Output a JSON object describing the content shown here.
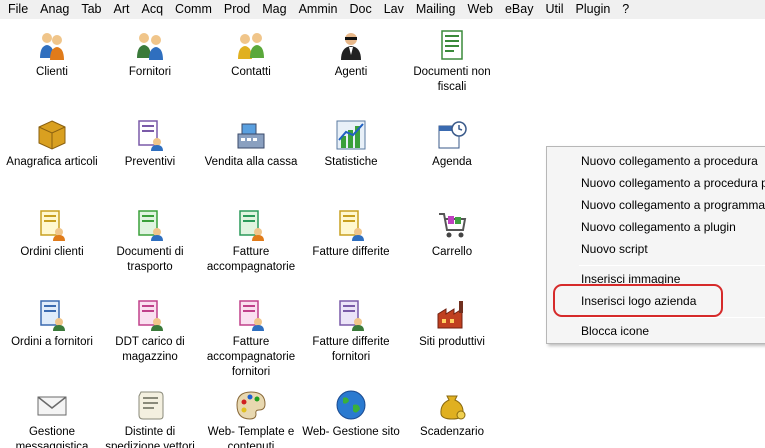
{
  "menubar": {
    "items": [
      "File",
      "Anag",
      "Tab",
      "Art",
      "Acq",
      "Comm",
      "Prod",
      "Mag",
      "Ammin",
      "Doc",
      "Lav",
      "Mailing",
      "Web",
      "eBay",
      "Util",
      "Plugin",
      "?"
    ]
  },
  "icons": {
    "clienti": "Clienti",
    "fornitori": "Fornitori",
    "contatti": "Contatti",
    "agenti": "Agenti",
    "documenti_non_fiscali": "Documenti non fiscali",
    "anagrafica_articoli": "Anagrafica articoli",
    "preventivi": "Preventivi",
    "vendita_alla_cassa": "Vendita alla cassa",
    "statistiche": "Statistiche",
    "agenda": "Agenda",
    "ordini_clienti": "Ordini clienti",
    "documenti_di_trasporto": "Documenti di trasporto",
    "fatture_accompagnatorie": "Fatture accompagnatorie",
    "fatture_differite": "Fatture differite",
    "carrello": "Carrello",
    "ordini_a_fornitori": "Ordini a fornitori",
    "ddt_carico_magazzino": "DDT carico di magazzino",
    "fatture_accompagnatorie_fornitori": "Fatture accompagnatorie fornitori",
    "fatture_differite_fornitori": "Fatture differite fornitori",
    "siti_produttivi": "Siti produttivi",
    "gestione_messaggistica": "Gestione messaggistica",
    "distinte_spedizione_vettori": "Distinte di spedizione vettori",
    "web_template_contenuti": "Web- Template e contenuti",
    "web_gestione_sito": "Web- Gestione sito",
    "scadenzario": "Scadenzario"
  },
  "context_menu": {
    "nuovo_collegamento_procedura": "Nuovo collegamento a procedura",
    "nuovo_collegamento_procedura_p": "Nuovo collegamento a procedura p",
    "nuovo_collegamento_programma": "Nuovo collegamento a programma",
    "nuovo_collegamento_plugin": "Nuovo collegamento a plugin",
    "nuovo_script": "Nuovo script",
    "inserisci_immagine": "Inserisci immagine",
    "inserisci_logo_azienda": "Inserisci logo azienda",
    "blocca_icone": "Blocca icone"
  },
  "colors": {
    "highlight_outline": "#d62a2a",
    "menubar_bg": "#f0f0f0",
    "context_menu_bg": "#f5f5f5"
  }
}
